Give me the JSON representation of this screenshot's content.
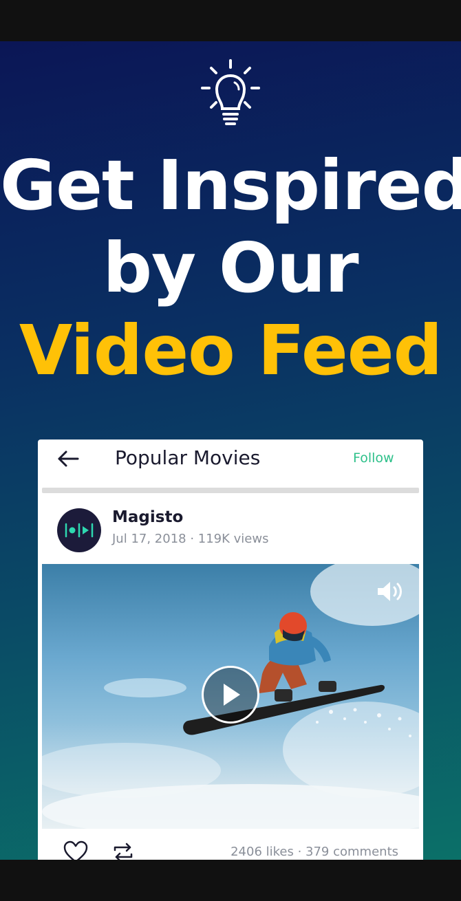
{
  "headline": {
    "line1": "Get Inspired",
    "line2": "by Our",
    "line3": "Video Feed"
  },
  "card": {
    "title": "Popular Movies",
    "follow_label": "Follow",
    "author": "Magisto",
    "meta": "Jul 17, 2018 · 119K views",
    "stats": "2406 likes · 379 comments"
  },
  "icons": [
    "lightbulb-icon",
    "back-arrow-icon",
    "magisto-logo-icon",
    "volume-icon",
    "play-icon",
    "heart-icon",
    "repost-icon"
  ],
  "colors": {
    "headline": "#ffffff",
    "headline_accent": "#ffc107",
    "follow": "#2ec08a",
    "avatar_bg": "#1c1b3a",
    "logo_accent": "#2ed8b0"
  }
}
